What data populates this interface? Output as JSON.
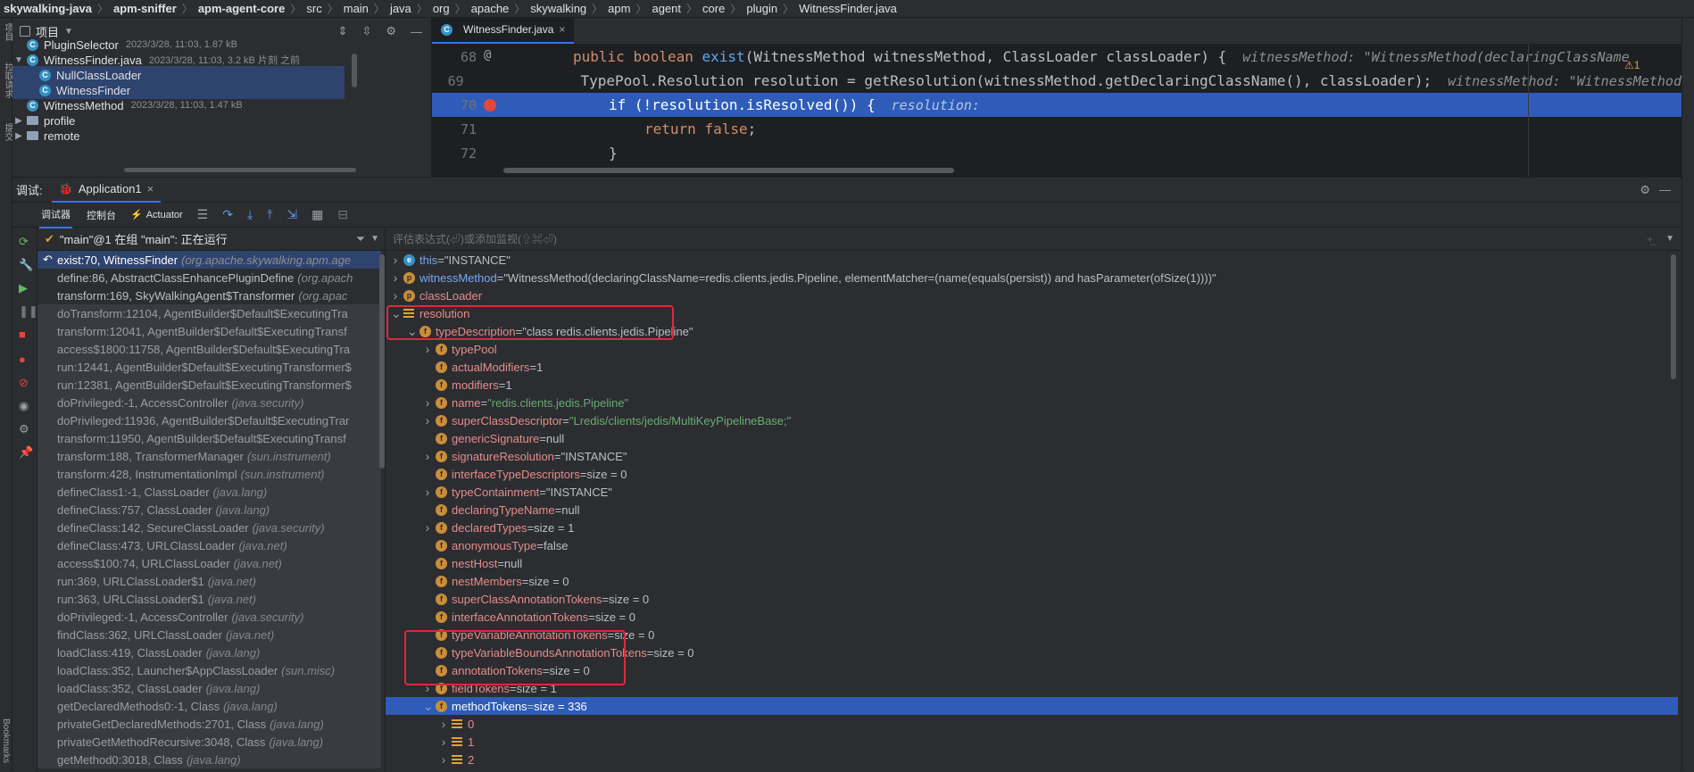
{
  "breadcrumbs": [
    "skywalking-java",
    "apm-sniffer",
    "apm-agent-core",
    "src",
    "main",
    "java",
    "org",
    "apache",
    "skywalking",
    "apm",
    "agent",
    "core",
    "plugin",
    "WitnessFinder.java"
  ],
  "project_panel": {
    "title": "项目",
    "items": [
      {
        "name": "PluginSelector",
        "meta": "2023/3/28, 11:03, 1.87 kB",
        "kind": "class"
      },
      {
        "name": "WitnessFinder.java",
        "meta": "2023/3/28, 11:03, 3.2 kB 片刻 之前",
        "kind": "class"
      },
      {
        "name": "NullClassLoader",
        "meta": "",
        "kind": "class"
      },
      {
        "name": "WitnessFinder",
        "meta": "",
        "kind": "class"
      },
      {
        "name": "WitnessMethod",
        "meta": "2023/3/28, 11:03, 1.47 kB",
        "kind": "class"
      },
      {
        "name": "profile",
        "meta": "",
        "kind": "folder"
      },
      {
        "name": "remote",
        "meta": "",
        "kind": "folder"
      }
    ]
  },
  "editor": {
    "tab": "WitnessFinder.java",
    "warnings": "⚠1",
    "lines": [
      {
        "num": "68",
        "code": "public boolean exist(WitnessMethod witnessMethod, ClassLoader classLoader) {",
        "hint": "witnessMethod: \"WitnessMethod(declaringClassName"
      },
      {
        "num": "69",
        "code": "TypePool.Resolution resolution = getResolution(witnessMethod.getDeclaringClassName(), classLoader);",
        "hint": "witnessMethod: \"WitnessMethod"
      },
      {
        "num": "70",
        "code": "if (!resolution.isResolved()) {",
        "hint": "resolution:"
      },
      {
        "num": "71",
        "code": "return false;",
        "hint": ""
      },
      {
        "num": "72",
        "code": "}",
        "hint": ""
      }
    ]
  },
  "debug": {
    "label": "调试:",
    "config": "Application1",
    "tabs": [
      "调试器",
      "控制台",
      "Actuator"
    ],
    "thread": "\"main\"@1 在组 \"main\": 正在运行",
    "eval_placeholder": "评估表达式(⏎)或添加监视(⇧⌘⏎)",
    "frames": [
      {
        "m": "exist:70, WitnessFinder",
        "p": "(org.apache.skywalking.apm.age"
      },
      {
        "m": "define:86, AbstractClassEnhancePluginDefine",
        "p": "(org.apach"
      },
      {
        "m": "transform:169, SkyWalkingAgent$Transformer",
        "p": "(org.apac"
      },
      {
        "m": "doTransform:12104, AgentBuilder$Default$ExecutingTra",
        "p": ""
      },
      {
        "m": "transform:12041, AgentBuilder$Default$ExecutingTransf",
        "p": ""
      },
      {
        "m": "access$1800:11758, AgentBuilder$Default$ExecutingTra",
        "p": ""
      },
      {
        "m": "run:12441, AgentBuilder$Default$ExecutingTransformer$",
        "p": ""
      },
      {
        "m": "run:12381, AgentBuilder$Default$ExecutingTransformer$",
        "p": ""
      },
      {
        "m": "doPrivileged:-1, AccessController",
        "p": "(java.security)"
      },
      {
        "m": "doPrivileged:11936, AgentBuilder$Default$ExecutingTrar",
        "p": ""
      },
      {
        "m": "transform:11950, AgentBuilder$Default$ExecutingTransf",
        "p": ""
      },
      {
        "m": "transform:188, TransformerManager",
        "p": "(sun.instrument)"
      },
      {
        "m": "transform:428, InstrumentationImpl",
        "p": "(sun.instrument)"
      },
      {
        "m": "defineClass1:-1, ClassLoader",
        "p": "(java.lang)"
      },
      {
        "m": "defineClass:757, ClassLoader",
        "p": "(java.lang)"
      },
      {
        "m": "defineClass:142, SecureClassLoader",
        "p": "(java.security)"
      },
      {
        "m": "defineClass:473, URLClassLoader",
        "p": "(java.net)"
      },
      {
        "m": "access$100:74, URLClassLoader",
        "p": "(java.net)"
      },
      {
        "m": "run:369, URLClassLoader$1",
        "p": "(java.net)"
      },
      {
        "m": "run:363, URLClassLoader$1",
        "p": "(java.net)"
      },
      {
        "m": "doPrivileged:-1, AccessController",
        "p": "(java.security)"
      },
      {
        "m": "findClass:362, URLClassLoader",
        "p": "(java.net)"
      },
      {
        "m": "loadClass:419, ClassLoader",
        "p": "(java.lang)"
      },
      {
        "m": "loadClass:352, Launcher$AppClassLoader",
        "p": "(sun.misc)"
      },
      {
        "m": "loadClass:352, ClassLoader",
        "p": "(java.lang)"
      },
      {
        "m": "getDeclaredMethods0:-1, Class",
        "p": "(java.lang)"
      },
      {
        "m": "privateGetDeclaredMethods:2701, Class",
        "p": "(java.lang)"
      },
      {
        "m": "privateGetMethodRecursive:3048, Class",
        "p": "(java.lang)"
      },
      {
        "m": "getMethod0:3018, Class",
        "p": "(java.lang)"
      }
    ],
    "variables": [
      {
        "name": "this",
        "value": "\"INSTANCE\"",
        "icon": "e",
        "depth": 0,
        "arrow": "closed",
        "blue": true,
        "str": false
      },
      {
        "name": "witnessMethod",
        "value": "\"WitnessMethod(declaringClassName=redis.clients.jedis.Pipeline, elementMatcher=(name(equals(persist)) and hasParameter(ofSize(1))))\"",
        "icon": "p",
        "depth": 0,
        "arrow": "closed",
        "blue": true,
        "str": false
      },
      {
        "name": "classLoader",
        "value": "",
        "icon": "p",
        "depth": 0,
        "arrow": "closed",
        "blue": false,
        "str": false
      },
      {
        "name": "resolution",
        "value": "",
        "icon": "l",
        "depth": 0,
        "arrow": "open",
        "blue": false,
        "str": false
      },
      {
        "name": "typeDescription",
        "value": "\"class redis.clients.jedis.Pipeline\"",
        "icon": "f",
        "depth": 1,
        "arrow": "open",
        "blue": false,
        "str": false
      },
      {
        "name": "typePool",
        "value": "",
        "icon": "f",
        "depth": 2,
        "arrow": "closed",
        "blue": false,
        "str": false
      },
      {
        "name": "actualModifiers",
        "value": "1",
        "icon": "f",
        "depth": 2,
        "arrow": "",
        "blue": false,
        "str": false
      },
      {
        "name": "modifiers",
        "value": "1",
        "icon": "f",
        "depth": 2,
        "arrow": "",
        "blue": false,
        "str": false
      },
      {
        "name": "name",
        "value": "\"redis.clients.jedis.Pipeline\"",
        "icon": "f",
        "depth": 2,
        "arrow": "closed",
        "blue": false,
        "str": true
      },
      {
        "name": "superClassDescriptor",
        "value": "\"Lredis/clients/jedis/MultiKeyPipelineBase;\"",
        "icon": "f",
        "depth": 2,
        "arrow": "closed",
        "blue": false,
        "str": true
      },
      {
        "name": "genericSignature",
        "value": "null",
        "icon": "f",
        "depth": 2,
        "arrow": "",
        "blue": false,
        "str": false
      },
      {
        "name": "signatureResolution",
        "value": "\"INSTANCE\"",
        "icon": "f",
        "depth": 2,
        "arrow": "closed",
        "blue": false,
        "str": false
      },
      {
        "name": "interfaceTypeDescriptors",
        "value": " size = 0",
        "icon": "f",
        "depth": 2,
        "arrow": "",
        "blue": false,
        "str": false
      },
      {
        "name": "typeContainment",
        "value": "\"INSTANCE\"",
        "icon": "f",
        "depth": 2,
        "arrow": "closed",
        "blue": false,
        "str": false
      },
      {
        "name": "declaringTypeName",
        "value": "null",
        "icon": "f",
        "depth": 2,
        "arrow": "",
        "blue": false,
        "str": false
      },
      {
        "name": "declaredTypes",
        "value": " size = 1",
        "icon": "f",
        "depth": 2,
        "arrow": "closed",
        "blue": false,
        "str": false
      },
      {
        "name": "anonymousType",
        "value": "false",
        "icon": "f",
        "depth": 2,
        "arrow": "",
        "blue": false,
        "str": false
      },
      {
        "name": "nestHost",
        "value": "null",
        "icon": "f",
        "depth": 2,
        "arrow": "",
        "blue": false,
        "str": false
      },
      {
        "name": "nestMembers",
        "value": " size = 0",
        "icon": "f",
        "depth": 2,
        "arrow": "",
        "blue": false,
        "str": false
      },
      {
        "name": "superClassAnnotationTokens",
        "value": " size = 0",
        "icon": "f",
        "depth": 2,
        "arrow": "",
        "blue": false,
        "str": false
      },
      {
        "name": "interfaceAnnotationTokens",
        "value": " size = 0",
        "icon": "f",
        "depth": 2,
        "arrow": "",
        "blue": false,
        "str": false
      },
      {
        "name": "typeVariableAnnotationTokens",
        "value": " size = 0",
        "icon": "f",
        "depth": 2,
        "arrow": "",
        "blue": false,
        "str": false
      },
      {
        "name": "typeVariableBoundsAnnotationTokens",
        "value": " size = 0",
        "icon": "f",
        "depth": 2,
        "arrow": "",
        "blue": false,
        "str": false
      },
      {
        "name": "annotationTokens",
        "value": " size = 0",
        "icon": "f",
        "depth": 2,
        "arrow": "",
        "blue": false,
        "str": false
      },
      {
        "name": "fieldTokens",
        "value": " size = 1",
        "icon": "f",
        "depth": 2,
        "arrow": "closed",
        "blue": false,
        "str": false
      },
      {
        "name": "methodTokens",
        "value": " size = 336",
        "icon": "f",
        "depth": 2,
        "arrow": "open",
        "blue": false,
        "str": false
      },
      {
        "name": "0",
        "value": "",
        "icon": "l",
        "depth": 3,
        "arrow": "closed",
        "blue": false,
        "str": false
      },
      {
        "name": "1",
        "value": "",
        "icon": "l",
        "depth": 3,
        "arrow": "closed",
        "blue": false,
        "str": false
      },
      {
        "name": "2",
        "value": "",
        "icon": "l",
        "depth": 3,
        "arrow": "closed",
        "blue": false,
        "str": false
      }
    ]
  },
  "side_labels": {
    "left_top": "项目",
    "left_mid": "拉取请求",
    "left_mid2": "提交",
    "left_bottom": "Bookmarks"
  }
}
